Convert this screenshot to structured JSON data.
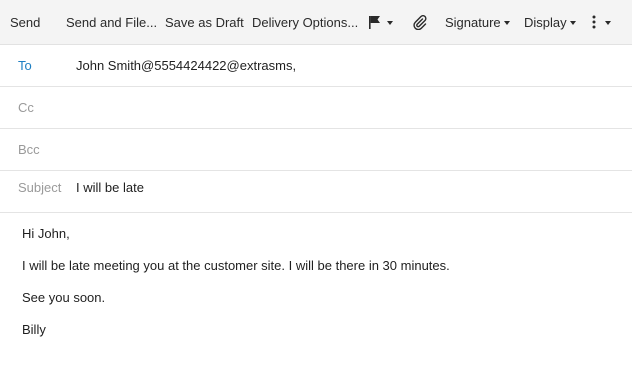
{
  "toolbar": {
    "send": "Send",
    "send_and_file": "Send and File...",
    "save_as_draft": "Save as Draft",
    "delivery_options": "Delivery Options...",
    "flag_icon": "flag-icon",
    "attach_icon": "paperclip-icon",
    "signature": "Signature",
    "display": "Display",
    "more_icon": "vertical-dots-icon"
  },
  "fields": {
    "to": {
      "label": "To",
      "value": "John Smith@5554424422@extrasms,"
    },
    "cc": {
      "label": "Cc",
      "value": ""
    },
    "bcc": {
      "label": "Bcc",
      "value": ""
    },
    "subject": {
      "label": "Subject",
      "value": "I will be late"
    }
  },
  "body": {
    "lines": [
      "Hi John,",
      "I will be late meeting you at the customer site. I will be there in 30 minutes.",
      "See you soon.",
      "Billy"
    ]
  },
  "colors": {
    "toolbar_bg": "#f4f4f4",
    "active_label": "#1e7fc2",
    "inactive_label": "#9a9a9a"
  }
}
